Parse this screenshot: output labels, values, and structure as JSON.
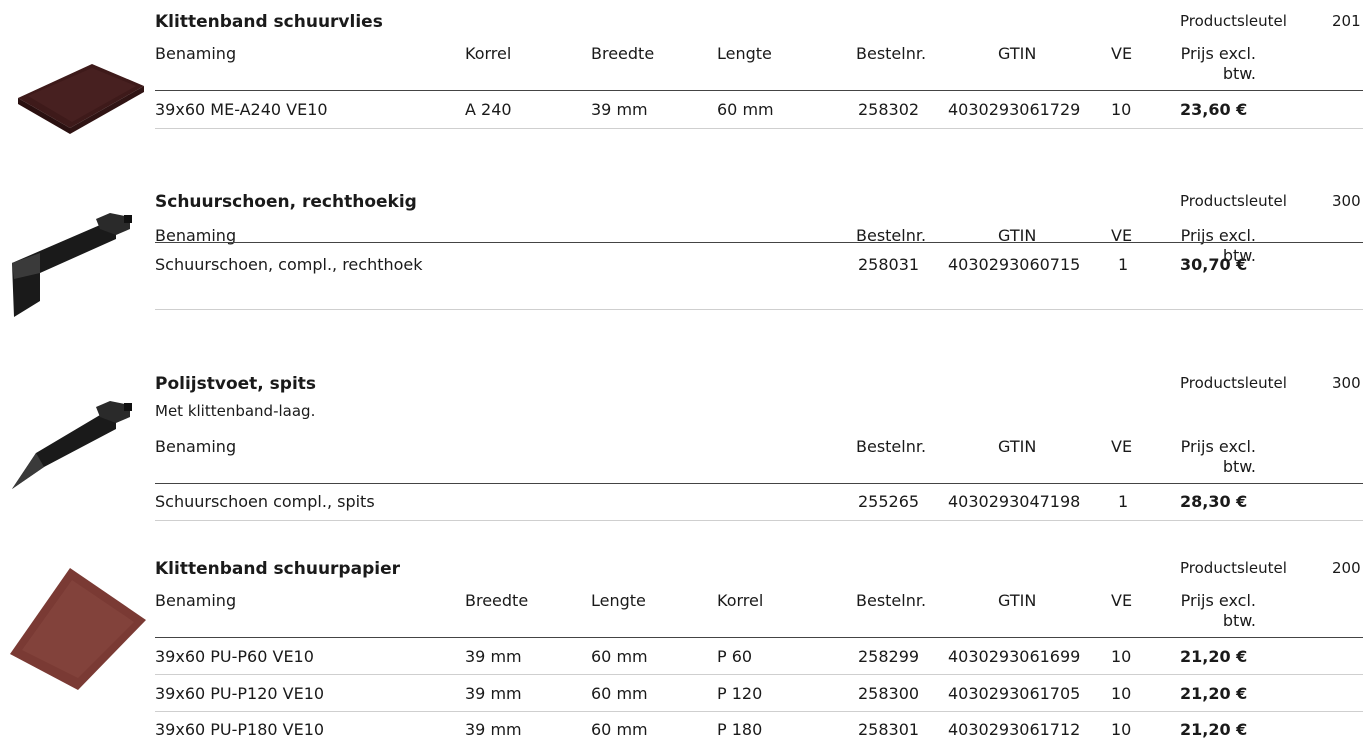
{
  "sections": [
    {
      "title": "Klittenband schuurvlies",
      "subtitle": "",
      "product_key_label": "Productsleutel",
      "product_key_value": "201",
      "headers": [
        "Benaming",
        "Korrel",
        "Breedte",
        "Lengte",
        "Bestelnr.",
        "GTIN",
        "VE",
        "Prijs excl.",
        "btw."
      ],
      "rows": [
        [
          "39x60 ME-A240 VE10",
          "A 240",
          "39 mm",
          "60 mm",
          "258302",
          "4030293061729",
          "10",
          "23,60 €"
        ]
      ]
    },
    {
      "title": "Schuurschoen, rechthoekig",
      "subtitle": "",
      "product_key_label": "Productsleutel",
      "product_key_value": "300",
      "headers": [
        "Benaming",
        "Bestelnr.",
        "GTIN",
        "VE",
        "Prijs excl.",
        "btw."
      ],
      "rows": [
        [
          "Schuurschoen, compl., rechthoek",
          "258031",
          "4030293060715",
          "1",
          "30,70 €"
        ]
      ]
    },
    {
      "title": "Polijstvoet, spits",
      "subtitle": "Met klittenband-laag.",
      "product_key_label": "Productsleutel",
      "product_key_value": "300",
      "headers": [
        "Benaming",
        "Bestelnr.",
        "GTIN",
        "VE",
        "Prijs excl.",
        "btw."
      ],
      "rows": [
        [
          "Schuurschoen compl., spits",
          "255265",
          "4030293047198",
          "1",
          "28,30 €"
        ]
      ]
    },
    {
      "title": "Klittenband schuurpapier",
      "subtitle": "",
      "product_key_label": "Productsleutel",
      "product_key_value": "200",
      "headers": [
        "Benaming",
        "Breedte",
        "Lengte",
        "Korrel",
        "Bestelnr.",
        "GTIN",
        "VE",
        "Prijs excl.",
        "btw."
      ],
      "rows": [
        [
          "39x60 PU-P60 VE10",
          "39 mm",
          "60 mm",
          "P 60",
          "258299",
          "4030293061699",
          "10",
          "21,20 €"
        ],
        [
          "39x60 PU-P120 VE10",
          "39 mm",
          "60 mm",
          "P 120",
          "258300",
          "4030293061705",
          "10",
          "21,20 €"
        ],
        [
          "39x60 PU-P180 VE10",
          "39 mm",
          "60 mm",
          "P 180",
          "258301",
          "4030293061712",
          "10",
          "21,20 €"
        ]
      ]
    }
  ],
  "colors": {
    "fleece": "#4a2020",
    "shoe": "#1f1f1f",
    "sandpaper": "#7a3a34"
  },
  "images": [
    "maroon-fleece-pad",
    "rectangular-sanding-shoe",
    "pointed-sanding-shoe",
    "red-sandpaper-sheet"
  ]
}
